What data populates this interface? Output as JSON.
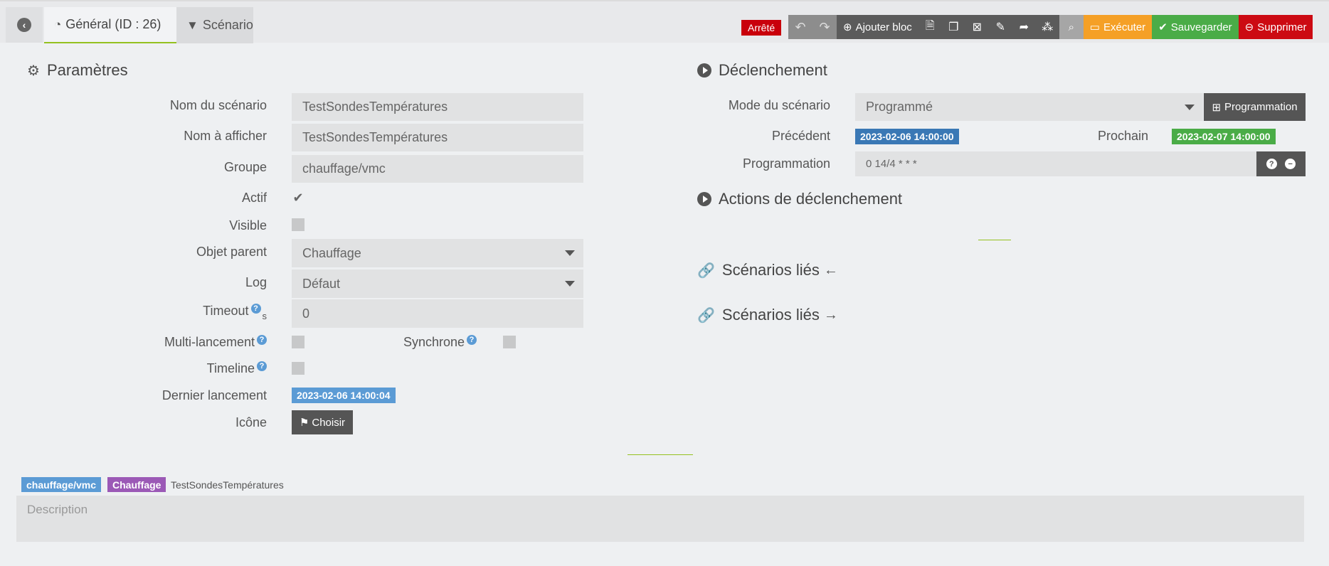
{
  "tabs": {
    "general": "Général (ID : 26)",
    "scenario": "Scénario"
  },
  "status": "Arrêté",
  "toolbar": {
    "add_block": "Ajouter bloc",
    "execute": "Exécuter",
    "save": "Sauvegarder",
    "delete": "Supprimer"
  },
  "params": {
    "title": "Paramètres",
    "name_label": "Nom du scénario",
    "name_value": "TestSondesTempératures",
    "display_label": "Nom à afficher",
    "display_value": "TestSondesTempératures",
    "group_label": "Groupe",
    "group_value": "chauffage/vmc",
    "active_label": "Actif",
    "visible_label": "Visible",
    "parent_label": "Objet parent",
    "parent_value": "Chauffage",
    "log_label": "Log",
    "log_value": "Défaut",
    "timeout_label": "Timeout",
    "timeout_unit": "s",
    "timeout_value": "0",
    "multi_label": "Multi-lancement",
    "sync_label": "Synchrone",
    "timeline_label": "Timeline",
    "last_run_label": "Dernier lancement",
    "last_run_value": "2023-02-06 14:00:04",
    "icon_label": "Icône",
    "choose_label": "Choisir"
  },
  "trigger": {
    "title": "Déclenchement",
    "mode_label": "Mode du scénario",
    "mode_value": "Programmé",
    "prog_button": "Programmation",
    "previous_label": "Précédent",
    "previous_value": "2023-02-06 14:00:00",
    "next_label": "Prochain",
    "next_value": "2023-02-07 14:00:00",
    "schedule_label": "Programmation",
    "schedule_value": "0 14/4 * * *"
  },
  "actions_title": "Actions de déclenchement",
  "linked_in_title": "Scénarios liés",
  "linked_out_title": "Scénarios liés",
  "footer": {
    "tag_group": "chauffage/vmc",
    "tag_parent": "Chauffage",
    "scenario_name": "TestSondesTempératures",
    "description_placeholder": "Description"
  },
  "colors": {
    "accent_green": "#94c11f",
    "status_red": "#c9000b",
    "execute_orange": "#f5a026",
    "save_green": "#4aac47",
    "delete_red": "#cc0a12",
    "badge_blue": "#5b9bd5",
    "badge_darkblue": "#3a78b5",
    "tag_purple": "#9b59b6"
  }
}
